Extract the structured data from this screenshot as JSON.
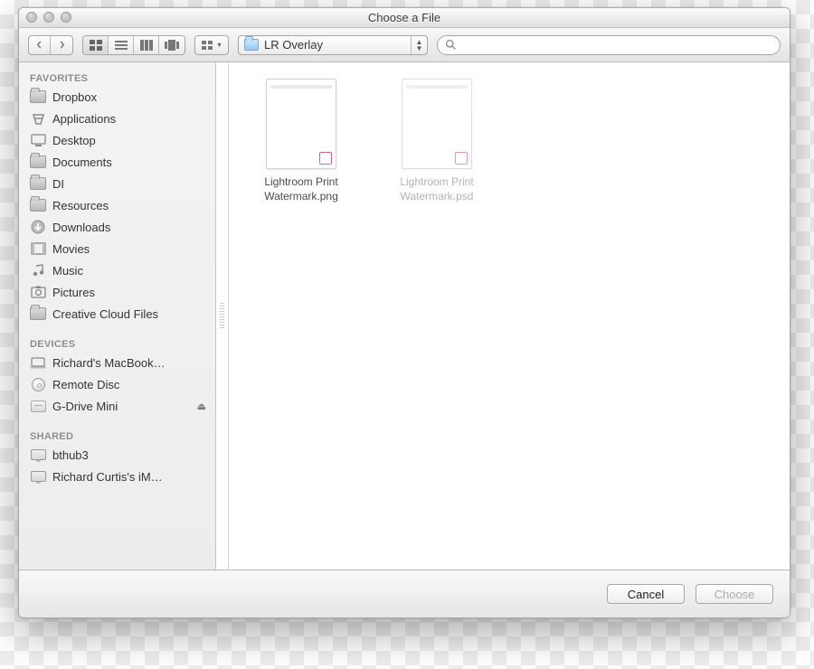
{
  "window_title": "Choose a File",
  "toolbar": {
    "path_label": "LR Overlay",
    "search_placeholder": ""
  },
  "sidebar": {
    "sections": [
      {
        "heading": "FAVORITES",
        "items": [
          {
            "label": "Dropbox",
            "icon": "folder"
          },
          {
            "label": "Applications",
            "icon": "apps"
          },
          {
            "label": "Desktop",
            "icon": "desktop"
          },
          {
            "label": "Documents",
            "icon": "folder"
          },
          {
            "label": "DI",
            "icon": "folder"
          },
          {
            "label": "Resources",
            "icon": "folder"
          },
          {
            "label": "Downloads",
            "icon": "downloads"
          },
          {
            "label": "Movies",
            "icon": "movies"
          },
          {
            "label": "Music",
            "icon": "music"
          },
          {
            "label": "Pictures",
            "icon": "pictures"
          },
          {
            "label": "Creative Cloud Files",
            "icon": "folder"
          }
        ]
      },
      {
        "heading": "DEVICES",
        "items": [
          {
            "label": "Richard's MacBook…",
            "icon": "laptop"
          },
          {
            "label": "Remote Disc",
            "icon": "disc"
          },
          {
            "label": "G-Drive Mini",
            "icon": "drive",
            "ejectable": true
          }
        ]
      },
      {
        "heading": "SHARED",
        "items": [
          {
            "label": "bthub3",
            "icon": "monitor"
          },
          {
            "label": "Richard Curtis's iM…",
            "icon": "monitor"
          }
        ]
      }
    ]
  },
  "files": [
    {
      "name_line1": "Lightroom Print",
      "name_line2": "Watermark.png",
      "selectable": true
    },
    {
      "name_line1": "Lightroom Print",
      "name_line2": "Watermark.psd",
      "selectable": false
    }
  ],
  "footer": {
    "cancel_label": "Cancel",
    "choose_label": "Choose"
  }
}
